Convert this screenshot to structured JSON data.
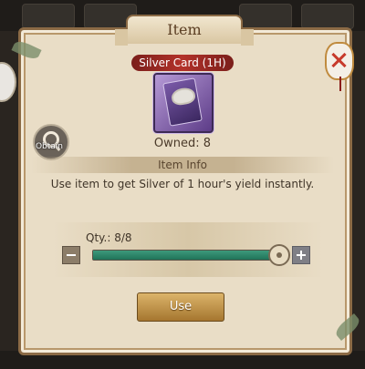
{
  "dialog": {
    "title": "Item",
    "item_name": "Silver Card (1H)",
    "owned_text": "Owned: 8",
    "obtain_label": "Obtain",
    "info_heading": "Item Info",
    "description": "Use item to get Silver of 1 hour's yield instantly.",
    "quantity_text": "Qty.: 8/8",
    "quantity_fraction": 1.0,
    "use_label": "Use"
  },
  "colors": {
    "accent_red": "#b3322a",
    "slider_fill": "#207358",
    "button_gold": "#dcb46a",
    "card_purple": "#5d3c88"
  },
  "icons": [
    "search-icon",
    "close-icon",
    "minus-icon",
    "plus-icon",
    "silver-card-icon"
  ]
}
